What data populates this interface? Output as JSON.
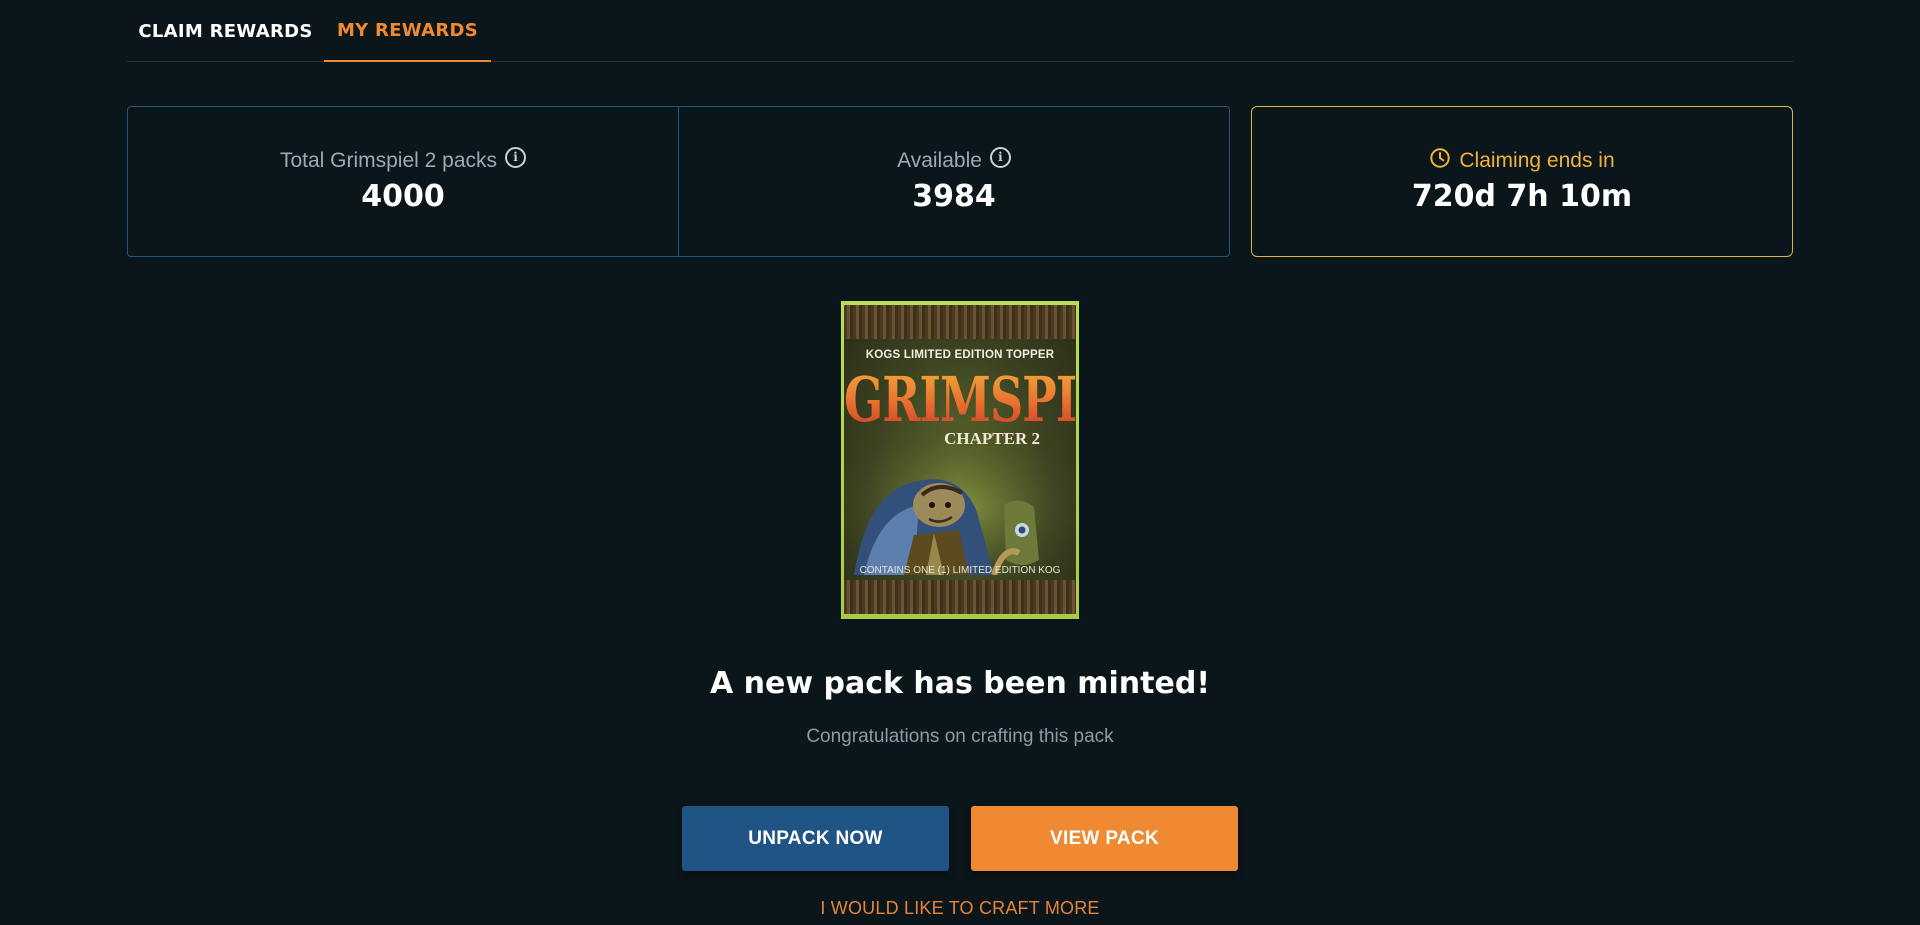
{
  "tabs": [
    {
      "label": "CLAIM REWARDS",
      "active": false
    },
    {
      "label": "MY REWARDS",
      "active": true
    }
  ],
  "stats": {
    "total": {
      "label": "Total Grimspiel 2 packs",
      "value": "4000",
      "icon": "info-icon"
    },
    "available": {
      "label": "Available",
      "value": "3984",
      "icon": "info-icon"
    },
    "ends": {
      "label": "Claiming ends in",
      "value": "720d 7h 10m",
      "icon": "clock-icon"
    }
  },
  "pack": {
    "brand": "KOGS LIMITED EDITION TOPPER",
    "title": "GRIMSPIEL",
    "chapter": "CHAPTER 2",
    "contains": "CONTAINS ONE (1) LIMITED EDITION KOG"
  },
  "message": {
    "headline": "A new pack has been minted!",
    "subline": "Congratulations on crafting this pack"
  },
  "buttons": {
    "unpack": "UNPACK NOW",
    "view": "VIEW PACK"
  },
  "craft_link": "I WOULD LIKE TO CRAFT MORE",
  "colors": {
    "background": "#0b161b",
    "accent_orange": "#ef8a33",
    "accent_blue": "#1f5485",
    "border_blue": "#24587a",
    "border_gold": "#e0b24a"
  }
}
